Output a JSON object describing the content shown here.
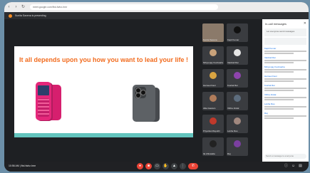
{
  "browser": {
    "url": "meet.google.com/fbd-fwhz-hmr"
  },
  "meeting": {
    "presenting_text": "Sunita Saxena is presenting",
    "time_code": "10:56 AM   |   fbd-fwhz-hmr"
  },
  "slide": {
    "title": "It all depends upon you how you want to lead your life !"
  },
  "participants": [
    {
      "name": "Sunita Saxena",
      "color": "#8b7a6a"
    },
    {
      "name": "Kapil Kumar",
      "color": "#111111"
    },
    {
      "name": "Mrityunjay Kushwaha",
      "color": "#c9a27a"
    },
    {
      "name": "Vaishali Rai",
      "color": "#e6e6e6"
    },
    {
      "name": "Harneet Kaur",
      "color": "#d9a441"
    },
    {
      "name": "Kushal Rai",
      "color": "#8e44ad"
    },
    {
      "name": "Alka Gautam",
      "color": "#b07c5a"
    },
    {
      "name": "Vibha Jindal",
      "color": "#5d6d7e"
    },
    {
      "name": "Priyanka Mayukhi",
      "color": "#c0392b"
    },
    {
      "name": "Lekha Rao",
      "color": "#a1887f"
    },
    {
      "name": "Ila Ahluwalia",
      "color": "#222222"
    },
    {
      "name": "Raj",
      "color": "#7b3fa0"
    }
  ],
  "chat": {
    "title": "In-call messages",
    "toggle_label": "Let everyone send messages",
    "messages": [
      {
        "name": "Kapil Kumar"
      },
      {
        "name": "Vaishali Rai"
      },
      {
        "name": "Mrityunjay Kushwaha"
      },
      {
        "name": "Harneet Kaur"
      },
      {
        "name": "Kushal Rai"
      },
      {
        "name": "Vibha Jindal"
      },
      {
        "name": "Lekha Rao"
      },
      {
        "name": "Raj"
      }
    ],
    "input_placeholder": "Send a message to everyone"
  }
}
